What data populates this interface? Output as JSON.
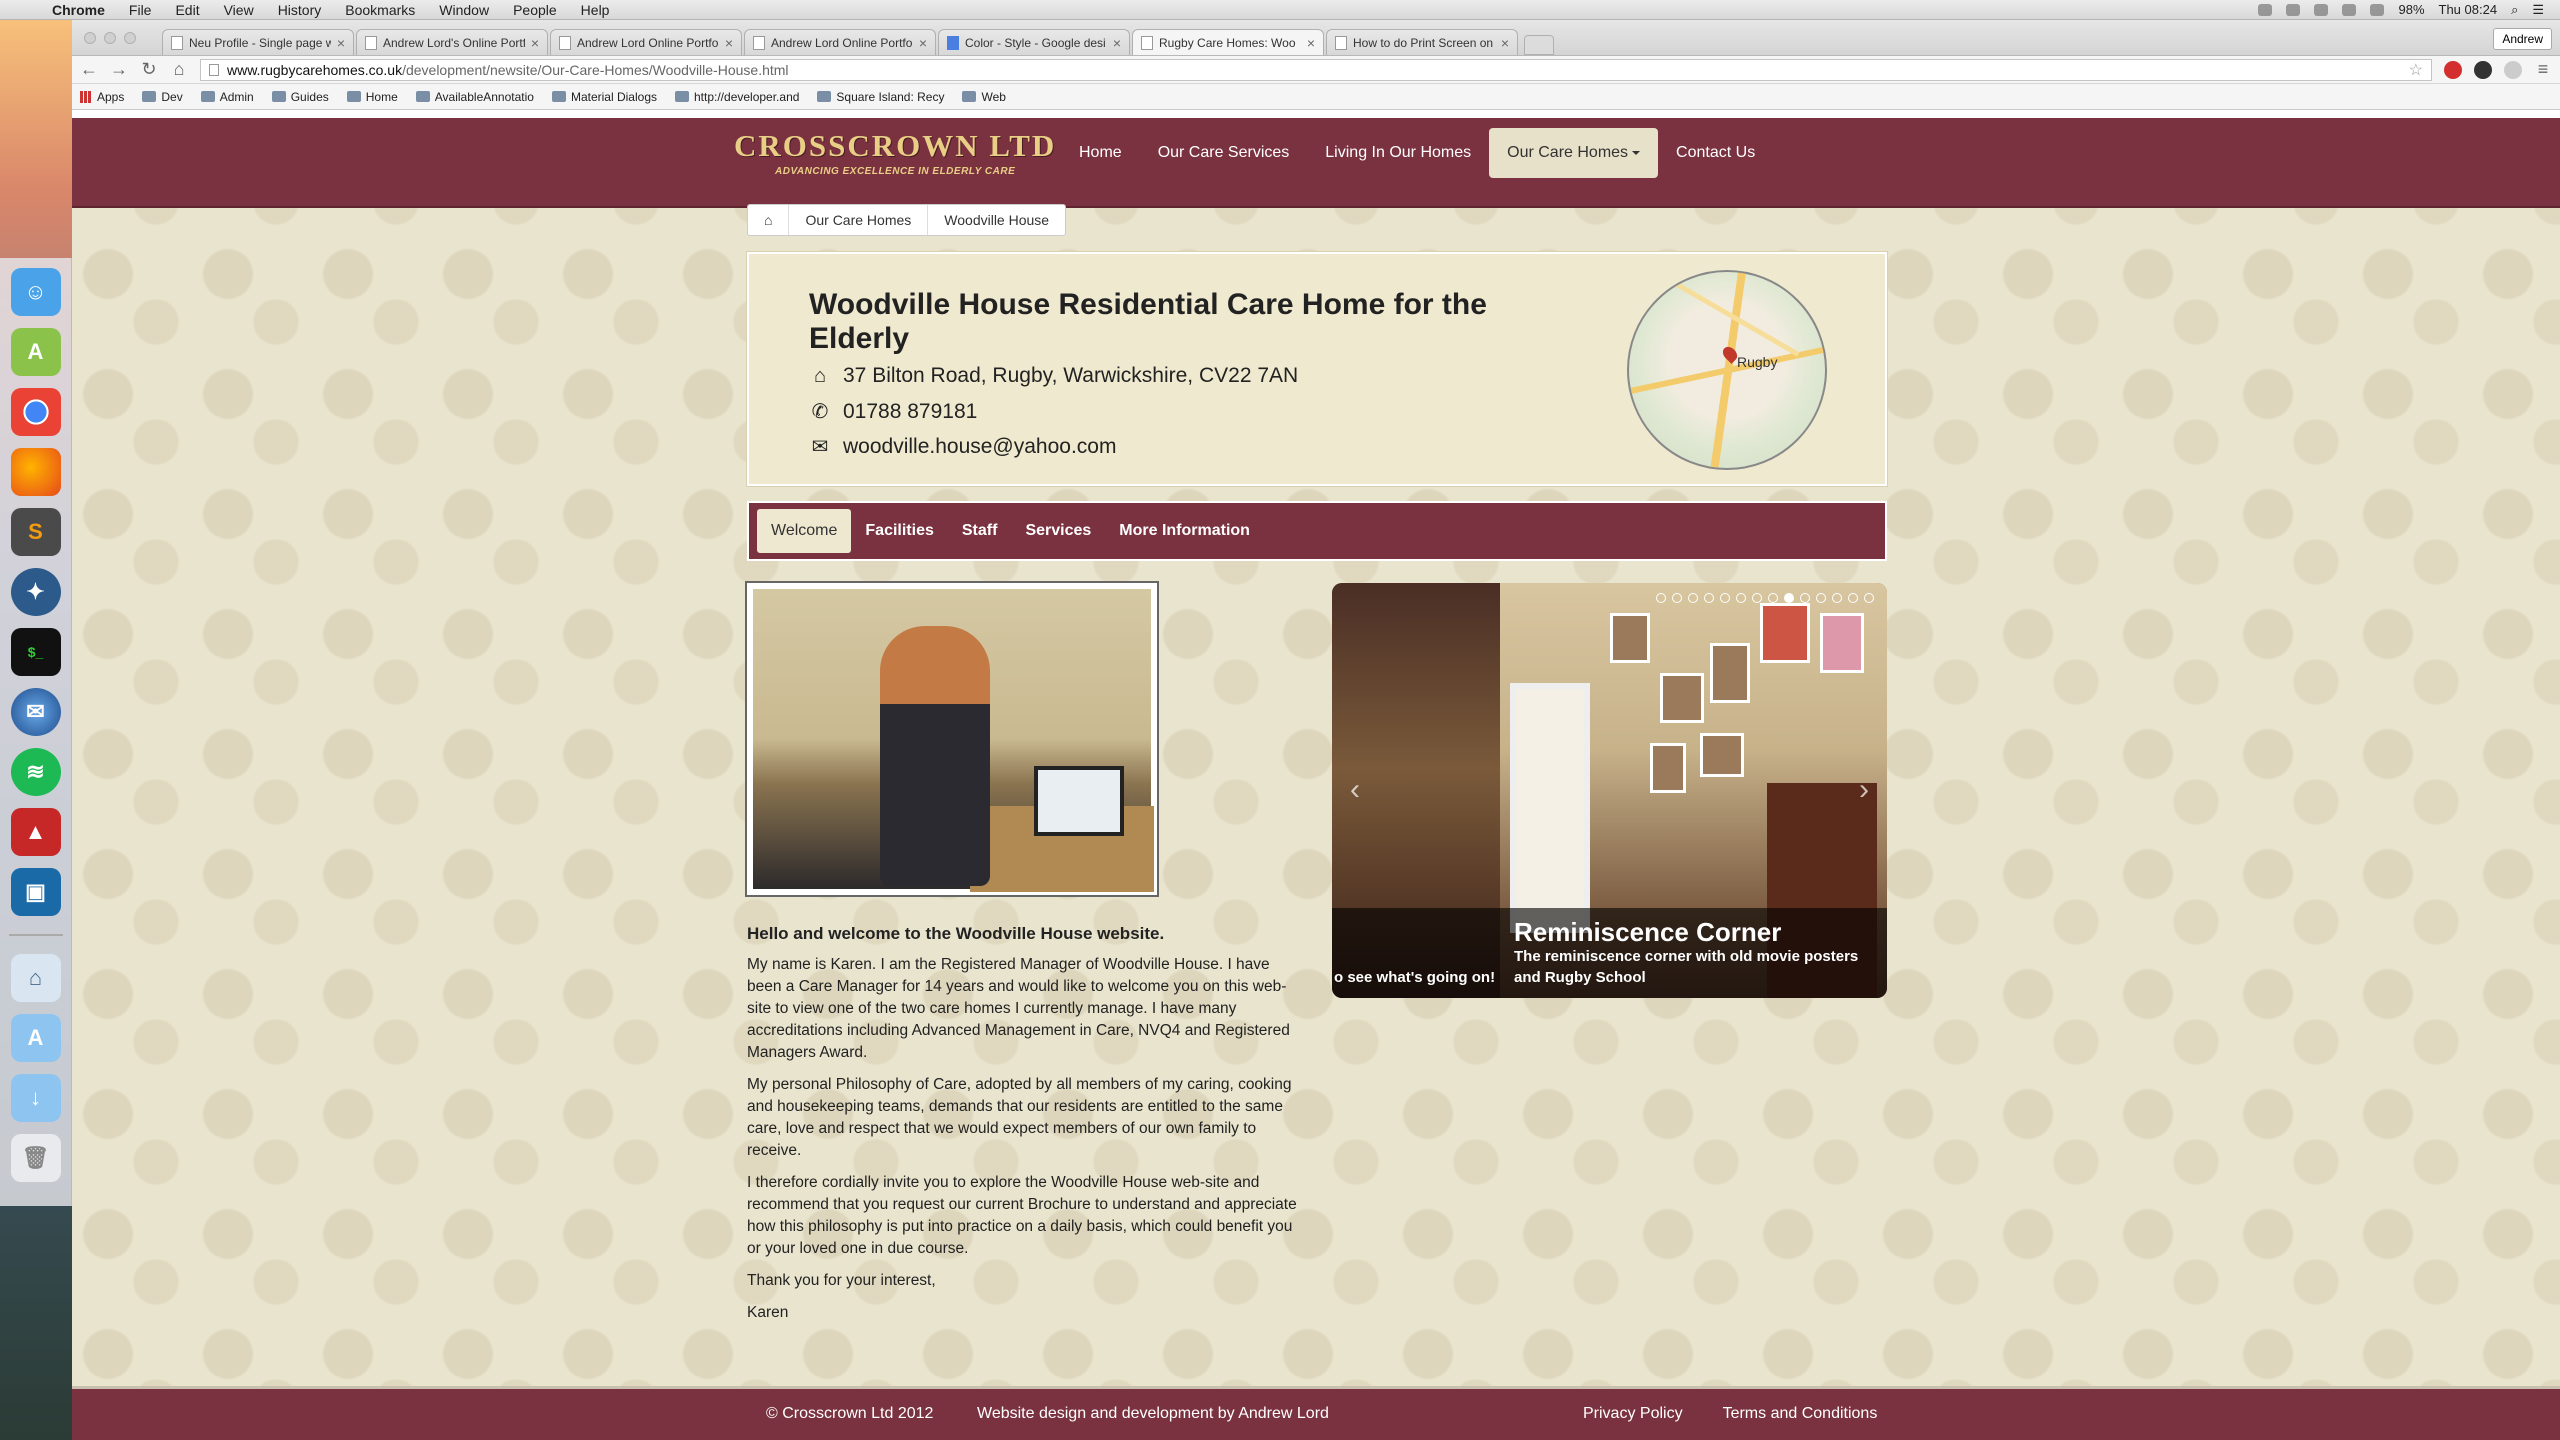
{
  "macmenu": {
    "app": "Chrome",
    "items": [
      "File",
      "Edit",
      "View",
      "History",
      "Bookmarks",
      "Window",
      "People",
      "Help"
    ],
    "battery": "98%",
    "clock": "Thu 08:24"
  },
  "browser": {
    "tabs": [
      {
        "title": "Neu Profile - Single page w"
      },
      {
        "title": "Andrew Lord's Online Portf"
      },
      {
        "title": "Andrew Lord Online Portfo"
      },
      {
        "title": "Andrew Lord Online Portfo"
      },
      {
        "title": "Color - Style - Google desi"
      },
      {
        "title": "Rugby Care Homes: Woo"
      },
      {
        "title": "How to do Print Screen on"
      }
    ],
    "active_tab_index": 5,
    "profile": "Andrew",
    "url_domain": "www.rugbycarehomes.co.uk",
    "url_path": "/development/newsite/Our-Care-Homes/Woodville-House.html",
    "bookmarks": [
      "Apps",
      "Dev",
      "Admin",
      "Guides",
      "Home",
      "AvailableAnnotatio",
      "Material Dialogs",
      "http://developer.and",
      "Square Island: Recy",
      "Web"
    ]
  },
  "site": {
    "logo_title": "CROSSCROWN LTD",
    "logo_tagline": "ADVANCING EXCELLENCE IN ELDERLY CARE",
    "nav": [
      {
        "label": "Home"
      },
      {
        "label": "Our Care Services"
      },
      {
        "label": "Living In Our Homes"
      },
      {
        "label": "Our Care Homes",
        "active": true
      },
      {
        "label": "Contact Us"
      }
    ],
    "breadcrumb": [
      "Our Care Homes",
      "Woodville House"
    ],
    "home": {
      "title": "Woodville House Residential Care Home for the Elderly",
      "address": "37 Bilton Road, Rugby, Warwickshire, CV22 7AN",
      "phone": "01788 879181",
      "email": "woodville.house@yahoo.com",
      "map_label": "Rugby"
    },
    "subnav": [
      "Welcome",
      "Facilities",
      "Staff",
      "Services",
      "More Information"
    ],
    "slider": {
      "prev_caption": "o see what's going on!",
      "title": "Reminiscence Corner",
      "text": "The reminiscence corner with old movie posters and Rugby School",
      "dots_total": 14,
      "active_dot": 8
    },
    "welcome": {
      "heading": "Hello and welcome to the Woodville House website.",
      "paragraphs": [
        "My name is Karen. I am the Registered Manager of Woodville House. I have been a Care Manager for 14 years and would like to welcome you on this web-site to view one of the two care homes I currently manage. I have many accreditations including Advanced Management in Care, NVQ4 and Registered Managers Award.",
        "My personal Philosophy of Care, adopted by all members of my caring, cooking and housekeeping teams, demands that our residents are entitled to the same care, love and respect that we would expect members of our own family to receive.",
        "I therefore cordially invite you to explore the Woodville House web-site and recommend that you request our current Brochure to understand and appreciate how this philosophy is put into practice on a daily basis, which could benefit you or your loved one in due course.",
        "Thank you for your interest,",
        "Karen"
      ]
    },
    "footer": {
      "copyright": "© Crosscrown Ltd 2012",
      "credit": "Website design and development by Andrew Lord",
      "privacy": "Privacy Policy",
      "terms": "Terms and Conditions"
    }
  }
}
